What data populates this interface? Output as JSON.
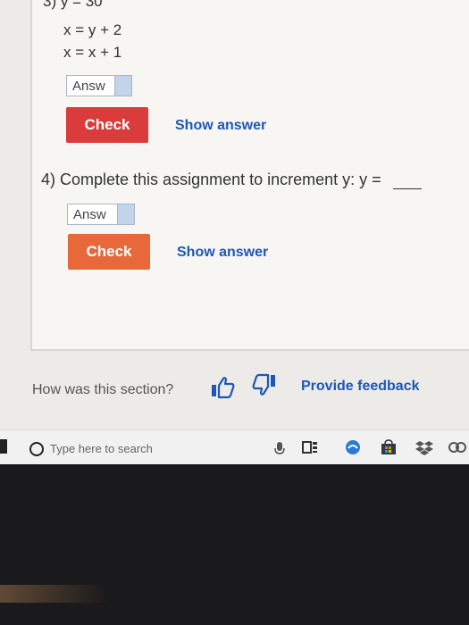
{
  "question3": {
    "line1": "3) y = 30",
    "line2": "x = y + 2",
    "line3": "x = x + 1",
    "answer_placeholder": "Answ",
    "check_label": "Check",
    "show_answer_label": "Show answer"
  },
  "question4": {
    "prompt": "4) Complete this assignment to increment y: y =",
    "answer_placeholder": "Answ",
    "check_label": "Check",
    "show_answer_label": "Show answer"
  },
  "feedback": {
    "question": "How was this section?",
    "link": "Provide feedback",
    "thumb_up_icon": "thumbs-up-icon",
    "thumb_down_icon": "thumbs-down-icon"
  },
  "taskbar": {
    "search_placeholder": "Type here to search",
    "icons": [
      "microphone-icon",
      "task-view-icon",
      "edge-icon",
      "store-icon",
      "dropbox-icon",
      "link-icon"
    ]
  },
  "colors": {
    "check_red": "#d93c3a",
    "check_orange": "#e8683b",
    "link_blue": "#1e57b7",
    "input_spin_blue": "#c3d3ea"
  }
}
